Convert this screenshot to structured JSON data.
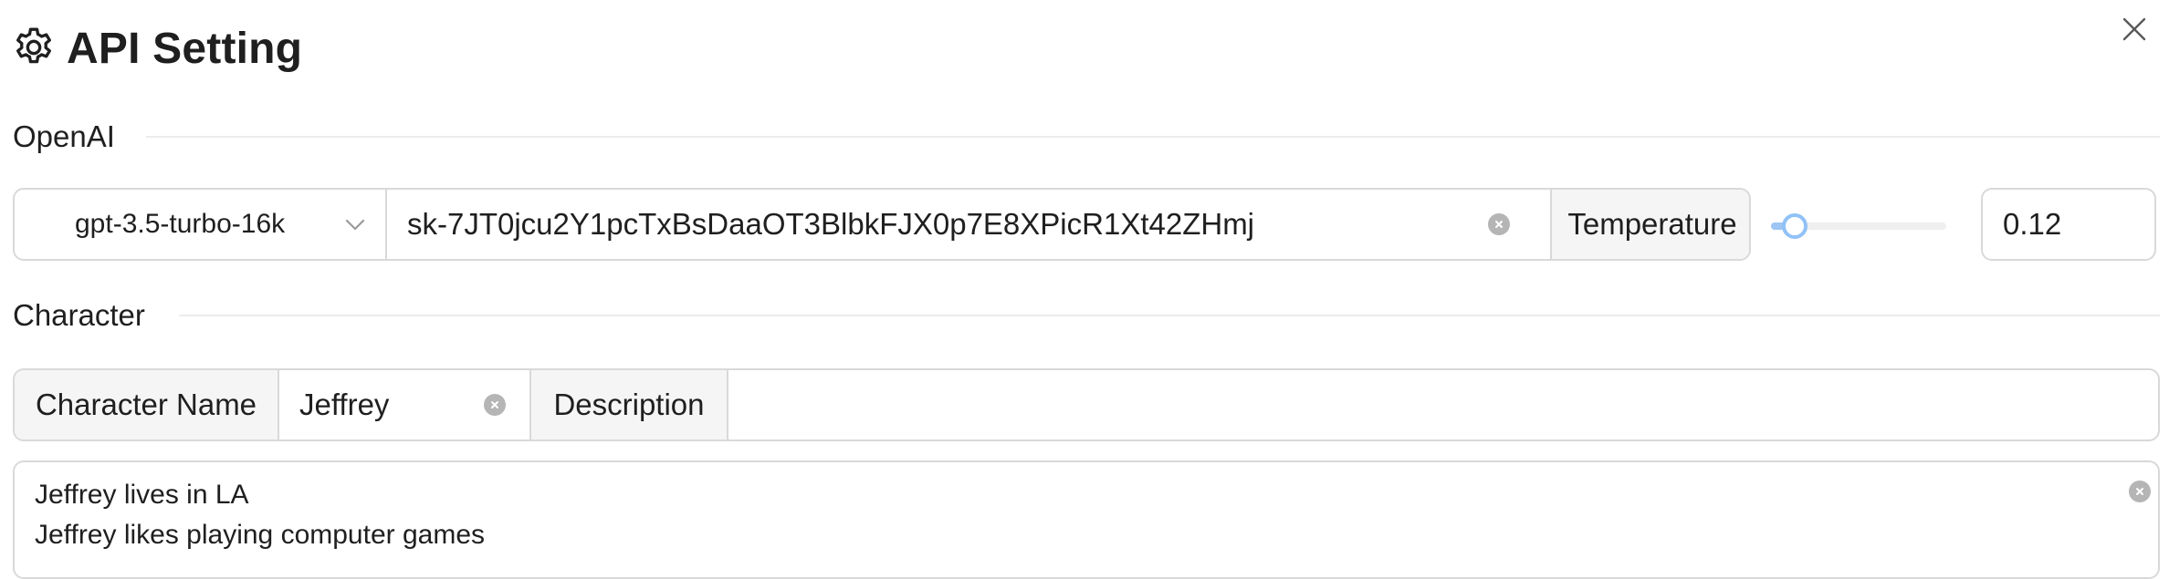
{
  "dialog": {
    "title": "API Setting",
    "icon": "gear-icon",
    "close_icon": "close-icon"
  },
  "openai": {
    "section_label": "OpenAI",
    "model": "gpt-3.5-turbo-16k",
    "api_key": "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",
    "temperature_label": "Temperature",
    "temperature_value": "0.12",
    "temperature_fraction": 0.12
  },
  "character": {
    "section_label": "Character",
    "name_label": "Character Name",
    "name_value": "Jeffrey",
    "description_label": "Description",
    "description_value": "",
    "details_lines": [
      "Jeffrey lives in LA",
      "Jeffrey likes playing computer games"
    ]
  },
  "colors": {
    "border": "#d9d9d9",
    "addon_bg": "#f5f5f5",
    "slider_accent": "#91c2f7"
  }
}
